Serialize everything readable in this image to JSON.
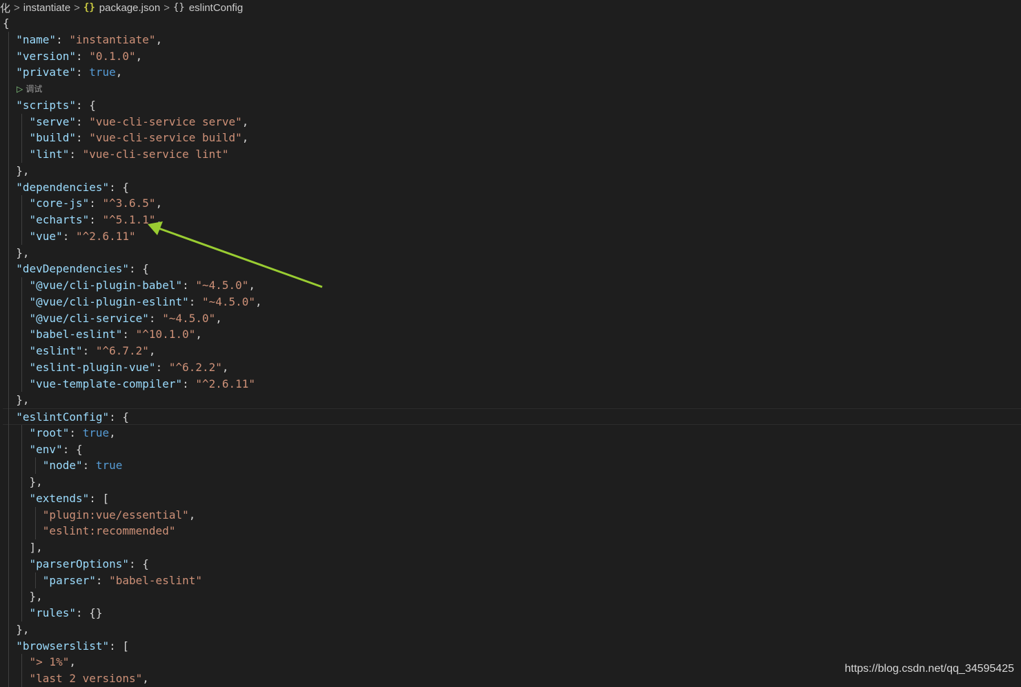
{
  "breadcrumb": {
    "truncated_prefix": "化",
    "folder": "instantiate",
    "file_icon": "{}",
    "file": "package.json",
    "symbol_icon": "{}",
    "symbol": "eslintConfig"
  },
  "codelens": {
    "label": "调试",
    "icon": "play-triangle"
  },
  "colors": {
    "key": "#9cdcfe",
    "string": "#ce9178",
    "boolean": "#569cd6",
    "punct": "#d4d4d4",
    "annotation_arrow": "#9acd32"
  },
  "watermark": "https://blog.csdn.net/qq_34595425",
  "annotation": {
    "type": "arrow",
    "points_to": "echarts version line"
  },
  "lines": [
    [
      [
        "q",
        "{"
      ]
    ],
    [
      [
        "q",
        "  "
      ],
      [
        "k",
        "\"name\""
      ],
      [
        "q",
        ": "
      ],
      [
        "s",
        "\"instantiate\""
      ],
      [
        "q",
        ","
      ]
    ],
    [
      [
        "q",
        "  "
      ],
      [
        "k",
        "\"version\""
      ],
      [
        "q",
        ": "
      ],
      [
        "s",
        "\"0.1.0\""
      ],
      [
        "q",
        ","
      ]
    ],
    [
      [
        "q",
        "  "
      ],
      [
        "k",
        "\"private\""
      ],
      [
        "q",
        ": "
      ],
      [
        "b",
        "true"
      ],
      [
        "q",
        ","
      ]
    ],
    [
      [
        "q",
        "  "
      ],
      [
        "k",
        "\"scripts\""
      ],
      [
        "q",
        ": {"
      ]
    ],
    [
      [
        "q",
        "    "
      ],
      [
        "k",
        "\"serve\""
      ],
      [
        "q",
        ": "
      ],
      [
        "s",
        "\"vue-cli-service serve\""
      ],
      [
        "q",
        ","
      ]
    ],
    [
      [
        "q",
        "    "
      ],
      [
        "k",
        "\"build\""
      ],
      [
        "q",
        ": "
      ],
      [
        "s",
        "\"vue-cli-service build\""
      ],
      [
        "q",
        ","
      ]
    ],
    [
      [
        "q",
        "    "
      ],
      [
        "k",
        "\"lint\""
      ],
      [
        "q",
        ": "
      ],
      [
        "s",
        "\"vue-cli-service lint\""
      ]
    ],
    [
      [
        "q",
        "  },"
      ]
    ],
    [
      [
        "q",
        "  "
      ],
      [
        "k",
        "\"dependencies\""
      ],
      [
        "q",
        ": {"
      ]
    ],
    [
      [
        "q",
        "    "
      ],
      [
        "k",
        "\"core-js\""
      ],
      [
        "q",
        ": "
      ],
      [
        "s",
        "\"^3.6.5\""
      ],
      [
        "q",
        ","
      ]
    ],
    [
      [
        "q",
        "    "
      ],
      [
        "k",
        "\"echarts\""
      ],
      [
        "q",
        ": "
      ],
      [
        "s",
        "\"^5.1.1\""
      ],
      [
        "q",
        ","
      ]
    ],
    [
      [
        "q",
        "    "
      ],
      [
        "k",
        "\"vue\""
      ],
      [
        "q",
        ": "
      ],
      [
        "s",
        "\"^2.6.11\""
      ]
    ],
    [
      [
        "q",
        "  },"
      ]
    ],
    [
      [
        "q",
        "  "
      ],
      [
        "k",
        "\"devDependencies\""
      ],
      [
        "q",
        ": {"
      ]
    ],
    [
      [
        "q",
        "    "
      ],
      [
        "k",
        "\"@vue/cli-plugin-babel\""
      ],
      [
        "q",
        ": "
      ],
      [
        "s",
        "\"~4.5.0\""
      ],
      [
        "q",
        ","
      ]
    ],
    [
      [
        "q",
        "    "
      ],
      [
        "k",
        "\"@vue/cli-plugin-eslint\""
      ],
      [
        "q",
        ": "
      ],
      [
        "s",
        "\"~4.5.0\""
      ],
      [
        "q",
        ","
      ]
    ],
    [
      [
        "q",
        "    "
      ],
      [
        "k",
        "\"@vue/cli-service\""
      ],
      [
        "q",
        ": "
      ],
      [
        "s",
        "\"~4.5.0\""
      ],
      [
        "q",
        ","
      ]
    ],
    [
      [
        "q",
        "    "
      ],
      [
        "k",
        "\"babel-eslint\""
      ],
      [
        "q",
        ": "
      ],
      [
        "s",
        "\"^10.1.0\""
      ],
      [
        "q",
        ","
      ]
    ],
    [
      [
        "q",
        "    "
      ],
      [
        "k",
        "\"eslint\""
      ],
      [
        "q",
        ": "
      ],
      [
        "s",
        "\"^6.7.2\""
      ],
      [
        "q",
        ","
      ]
    ],
    [
      [
        "q",
        "    "
      ],
      [
        "k",
        "\"eslint-plugin-vue\""
      ],
      [
        "q",
        ": "
      ],
      [
        "s",
        "\"^6.2.2\""
      ],
      [
        "q",
        ","
      ]
    ],
    [
      [
        "q",
        "    "
      ],
      [
        "k",
        "\"vue-template-compiler\""
      ],
      [
        "q",
        ": "
      ],
      [
        "s",
        "\"^2.6.11\""
      ]
    ],
    [
      [
        "q",
        "  },"
      ]
    ],
    [
      [
        "q",
        "  "
      ],
      [
        "k",
        "\"eslintConfig\""
      ],
      [
        "q",
        ": {"
      ]
    ],
    [
      [
        "q",
        "    "
      ],
      [
        "k",
        "\"root\""
      ],
      [
        "q",
        ": "
      ],
      [
        "b",
        "true"
      ],
      [
        "q",
        ","
      ]
    ],
    [
      [
        "q",
        "    "
      ],
      [
        "k",
        "\"env\""
      ],
      [
        "q",
        ": {"
      ]
    ],
    [
      [
        "q",
        "      "
      ],
      [
        "k",
        "\"node\""
      ],
      [
        "q",
        ": "
      ],
      [
        "b",
        "true"
      ]
    ],
    [
      [
        "q",
        "    },"
      ]
    ],
    [
      [
        "q",
        "    "
      ],
      [
        "k",
        "\"extends\""
      ],
      [
        "q",
        ": ["
      ]
    ],
    [
      [
        "q",
        "      "
      ],
      [
        "s",
        "\"plugin:vue/essential\""
      ],
      [
        "q",
        ","
      ]
    ],
    [
      [
        "q",
        "      "
      ],
      [
        "s",
        "\"eslint:recommended\""
      ]
    ],
    [
      [
        "q",
        "    ],"
      ]
    ],
    [
      [
        "q",
        "    "
      ],
      [
        "k",
        "\"parserOptions\""
      ],
      [
        "q",
        ": {"
      ]
    ],
    [
      [
        "q",
        "      "
      ],
      [
        "k",
        "\"parser\""
      ],
      [
        "q",
        ": "
      ],
      [
        "s",
        "\"babel-eslint\""
      ]
    ],
    [
      [
        "q",
        "    },"
      ]
    ],
    [
      [
        "q",
        "    "
      ],
      [
        "k",
        "\"rules\""
      ],
      [
        "q",
        ": {}"
      ]
    ],
    [
      [
        "q",
        "  },"
      ]
    ],
    [
      [
        "q",
        "  "
      ],
      [
        "k",
        "\"browserslist\""
      ],
      [
        "q",
        ": ["
      ]
    ],
    [
      [
        "q",
        "    "
      ],
      [
        "s",
        "\"> 1%\""
      ],
      [
        "q",
        ","
      ]
    ],
    [
      [
        "q",
        "    "
      ],
      [
        "s",
        "\"last 2 versions\""
      ],
      [
        "q",
        ","
      ]
    ]
  ]
}
